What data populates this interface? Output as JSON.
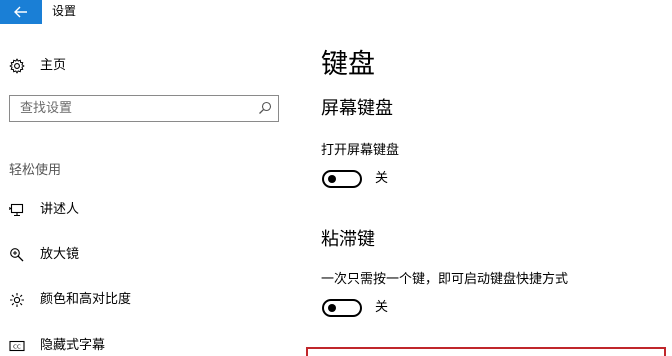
{
  "window": {
    "title": "设置",
    "back_icon": "back-arrow-icon",
    "accent_color": "#1a7fd6"
  },
  "sidebar": {
    "home": {
      "label": "主页",
      "icon": "gear-icon"
    },
    "search": {
      "placeholder": "查找设置",
      "value": "",
      "icon": "search-icon"
    },
    "section_header": "轻松使用",
    "items": [
      {
        "label": "讲述人",
        "icon": "narrator-icon"
      },
      {
        "label": "放大镜",
        "icon": "magnifier-icon"
      },
      {
        "label": "颜色和高对比度",
        "icon": "brightness-icon"
      },
      {
        "label": "隐藏式字幕",
        "icon": "closed-captions-icon"
      }
    ]
  },
  "main": {
    "title": "键盘",
    "sections": [
      {
        "title": "屏幕键盘",
        "setting_label": "打开屏幕键盘",
        "toggle_state": "关",
        "toggle_on": false
      },
      {
        "title": "粘滞键",
        "setting_label": "一次只需按一个键，即可启动键盘快捷方式",
        "toggle_state": "关",
        "toggle_on": false
      }
    ],
    "highlight_color": "#c0262b"
  }
}
